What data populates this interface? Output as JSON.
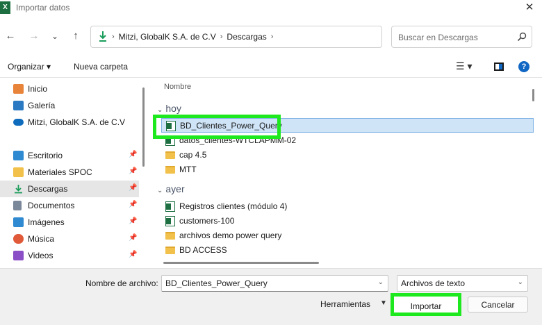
{
  "window": {
    "title": "Importar datos",
    "app_icon": "X"
  },
  "nav": {
    "back_icon": "←",
    "forward_icon": "→",
    "recent_icon": "⌄",
    "up_icon": "↑"
  },
  "address": {
    "crumbs": [
      "Mitzi, GlobalK S.A. de C.V",
      "Descargas"
    ],
    "separator": "›",
    "dropdown_icon": "⌄",
    "refresh_icon": "↻"
  },
  "search": {
    "placeholder": "Buscar en Descargas"
  },
  "toolbar": {
    "organize_label": "Organizar ▾",
    "new_folder_label": "Nueva carpeta",
    "view_icon": "☰ ▾",
    "help_icon": "?"
  },
  "sidebar": {
    "items": [
      {
        "label": "Inicio",
        "icon": "home-icon",
        "color": "#e8833a",
        "pinned": false
      },
      {
        "label": "Galería",
        "icon": "gallery-icon",
        "color": "#2b79c2",
        "pinned": false
      },
      {
        "label": "Mitzi, GlobalK S.A. de C.V",
        "icon": "onedrive-icon",
        "color": "#0f6cbd",
        "pinned": false
      },
      {
        "label": "Escritorio",
        "icon": "desktop-icon",
        "color": "#2f8ad1",
        "pinned": true
      },
      {
        "label": "Materiales SPOC",
        "icon": "folder-icon",
        "color": "#f2c14b",
        "pinned": true
      },
      {
        "label": "Descargas",
        "icon": "downloads-icon",
        "color": "#1a9c5a",
        "pinned": true
      },
      {
        "label": "Documentos",
        "icon": "documents-icon",
        "color": "#7a8899",
        "pinned": true
      },
      {
        "label": "Imágenes",
        "icon": "pictures-icon",
        "color": "#2f8ad1",
        "pinned": true
      },
      {
        "label": "Música",
        "icon": "music-icon",
        "color": "#e05a3a",
        "pinned": true
      },
      {
        "label": "Videos",
        "icon": "videos-icon",
        "color": "#8a4fc7",
        "pinned": true
      }
    ],
    "pin_icon": "📌"
  },
  "filelist": {
    "column_name": "Nombre",
    "groups": [
      {
        "label": "hoy",
        "files": [
          {
            "name": "BD_Clientes_Power_Query",
            "type": "xls",
            "selected": true
          },
          {
            "name": "datos_clientes-WTCLAPMM-02",
            "type": "xls",
            "selected": false
          },
          {
            "name": "cap 4.5",
            "type": "folder",
            "selected": false
          },
          {
            "name": "MTT",
            "type": "folder",
            "selected": false
          }
        ]
      },
      {
        "label": "ayer",
        "files": [
          {
            "name": "Registros clientes (módulo 4)",
            "type": "xls",
            "selected": false
          },
          {
            "name": "customers-100",
            "type": "xls",
            "selected": false
          },
          {
            "name": "archivos demo power query",
            "type": "folder",
            "selected": false
          },
          {
            "name": "BD ACCESS",
            "type": "folder",
            "selected": false
          }
        ]
      }
    ]
  },
  "bottom": {
    "filename_label": "Nombre de archivo:",
    "filename_value": "BD_Clientes_Power_Query",
    "filetype_value": "Archivos de texto",
    "tools_label": "Herramientas",
    "import_label": "Importar",
    "cancel_label": "Cancelar"
  },
  "colors": {
    "highlight": "#1ee81e",
    "selection": "#cfe4f7",
    "accent": "#1167c4"
  }
}
